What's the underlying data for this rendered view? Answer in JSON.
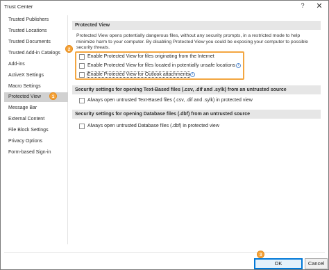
{
  "window": {
    "title": "Trust Center",
    "help_glyph": "?",
    "close_glyph": "✕"
  },
  "sidebar": {
    "items": [
      {
        "label": "Trusted Publishers"
      },
      {
        "label": "Trusted Locations"
      },
      {
        "label": "Trusted Documents"
      },
      {
        "label": "Trusted Add-in Catalogs"
      },
      {
        "label": "Add-ins"
      },
      {
        "label": "ActiveX Settings"
      },
      {
        "label": "Macro Settings"
      },
      {
        "label": "Protected View"
      },
      {
        "label": "Message Bar"
      },
      {
        "label": "External Content"
      },
      {
        "label": "File Block Settings"
      },
      {
        "label": "Privacy Options"
      },
      {
        "label": "Form-based Sign-in"
      }
    ],
    "selected_index": 7
  },
  "markers": {
    "m1": "1",
    "m2": "2",
    "m3": "3"
  },
  "sections": {
    "protected_view": {
      "header": "Protected View",
      "description": "Protected View opens potentially dangerous files, without any security prompts, in a restricted mode to help minimize harm to your computer. By disabling Protected View you could be exposing your computer to possible security threats.",
      "options": [
        {
          "label": "Enable Protected View for files originating from the Internet",
          "checked": false
        },
        {
          "label": "Enable Protected View for files located in potentially unsafe locations",
          "checked": false
        },
        {
          "label": "Enable Protected View for Outlook attachments",
          "checked": false
        }
      ]
    },
    "text_files": {
      "header": "Security settings for opening Text-Based files (.csv, .dif and .sylk) from an untrusted source",
      "option": {
        "label": "Always open untrusted Text-Based files (.csv, .dif and .sylk) in protected view",
        "checked": false
      }
    },
    "database_files": {
      "header": "Security settings for opening Database files (.dbf) from an untrusted source",
      "option": {
        "label": "Always open untrusted Database files (.dbf) in protected view",
        "checked": false
      }
    }
  },
  "info_glyph": "i",
  "buttons": {
    "ok": "OK",
    "cancel": "Cancel"
  },
  "colors": {
    "accent_orange": "#f3a640",
    "selected_bg": "#d1d1d1",
    "section_bg": "#e6e6e6",
    "ok_border": "#0078d7"
  }
}
